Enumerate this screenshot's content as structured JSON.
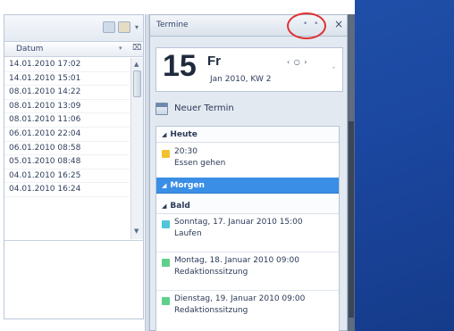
{
  "left_pane": {
    "column_header": "Datum",
    "rows": [
      "14.01.2010 17:02",
      "14.01.2010 15:01",
      "08.01.2010 14:22",
      "08.01.2010 13:09",
      "08.01.2010 11:06",
      "06.01.2010 22:04",
      "06.01.2010 08:58",
      "05.01.2010 08:48",
      "04.01.2010 16:25",
      "04.01.2010 16:24"
    ]
  },
  "calendar": {
    "title": "Termine",
    "day_number": "15",
    "weekday": "Fr",
    "month_info": "Jan 2010, KW 2",
    "nav_symbols": "‹ ○ ›",
    "more_symbol": "˯",
    "new_appointment": "Neuer Termin",
    "groups": {
      "today": "Heute",
      "tomorrow": "Morgen",
      "soon": "Bald"
    },
    "appointments": [
      {
        "when": "20:30",
        "what": "Essen gehen",
        "color": "#f2c22e"
      },
      {
        "when": "Sonntag, 17. Januar 2010 15:00",
        "what": "Laufen",
        "color": "#4fc7d9"
      },
      {
        "when": "Montag, 18. Januar 2010 09:00",
        "what": "Redaktionssitzung",
        "color": "#5ed08a"
      },
      {
        "when": "Dienstag, 19. Januar 2010 09:00",
        "what": "Redaktionssitzung",
        "color": "#5ed08a"
      }
    ]
  },
  "colors": {
    "selection": "#3a8ee6",
    "annotation_circle": "#e0302e",
    "desktop": "#1f4fa8"
  }
}
